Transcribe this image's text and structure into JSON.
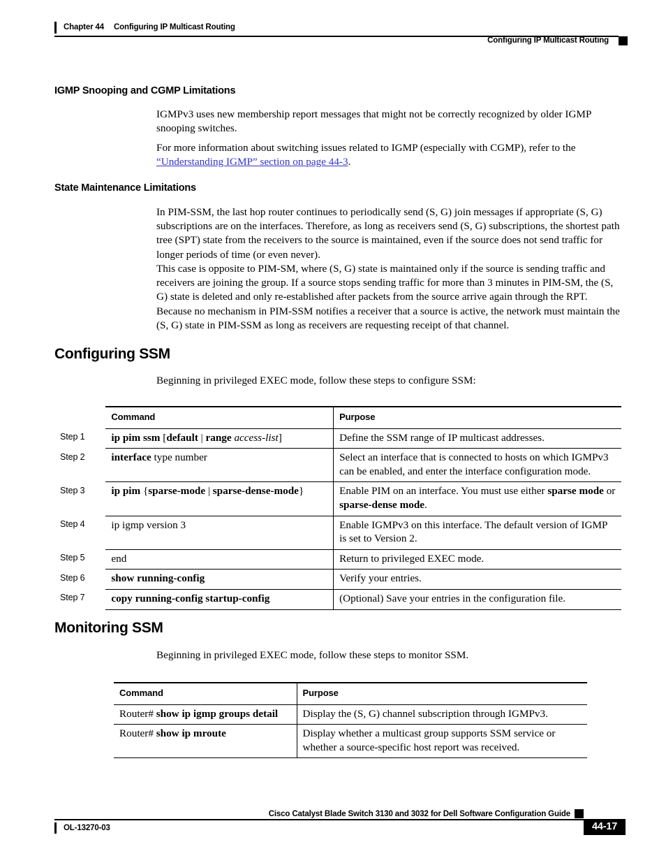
{
  "header": {
    "chapter_number": "Chapter 44",
    "chapter_title": "Configuring IP Multicast Routing",
    "running_title": "Configuring IP Multicast Routing"
  },
  "sections": {
    "igmp_snooping": {
      "heading": "IGMP Snooping and CGMP Limitations",
      "para1": "IGMPv3 uses new membership report messages that might not be correctly recognized by older IGMP snooping switches.",
      "para2_prefix": "For more information about switching issues related to IGMP (especially with CGMP), refer to the ",
      "para2_link": "“Understanding IGMP” section on page 44-3",
      "para2_suffix": "."
    },
    "state_maintenance": {
      "heading": "State Maintenance Limitations",
      "para1": "In PIM-SSM, the last hop router continues to periodically send (S, G) join messages if appropriate (S, G) subscriptions are on the interfaces. Therefore, as long as receivers send (S, G) subscriptions, the shortest path tree (SPT) state from the receivers to the source is maintained, even if the source does not send traffic for longer periods of time (or even never).",
      "para2": "This case is opposite to PIM-SM, where (S, G) state is maintained only if the source is sending traffic and receivers are joining the group. If a source stops sending traffic for more than 3 minutes in PIM-SM, the (S, G) state is deleted and only re-established after packets from the source arrive again through the RPT. Because no mechanism in PIM-SSM notifies a receiver that a source is active, the network must maintain the (S, G) state in PIM-SSM as long as receivers are requesting receipt of that channel."
    },
    "configuring_ssm": {
      "heading": "Configuring SSM",
      "intro": "Beginning in privileged EXEC mode, follow these steps to configure SSM:",
      "table": {
        "col_command": "Command",
        "col_purpose": "Purpose",
        "rows": [
          {
            "step": "Step 1",
            "command_html": "<b>ip pim ssm</b> [<b>default</b> | <b>range</b> <i>access-list</i>]",
            "command_text": "ip pim ssm [default | range access-list]",
            "purpose": "Define the SSM range of IP multicast addresses."
          },
          {
            "step": "Step 2",
            "command_html": "<b>interface</b> type number",
            "command_text": "interface type number",
            "purpose": "Select an interface that is connected to hosts on which IGMPv3 can be enabled, and enter the interface configuration mode."
          },
          {
            "step": "Step 3",
            "command_html": "<b>ip pim</b> {<b>sparse-mode</b> | <b>sparse-dense-mode</b>}",
            "command_text": "ip pim {sparse-mode | sparse-dense-mode}",
            "purpose_html": "Enable PIM on an interface. You must use either <b>sparse mode</b> or <b>sparse-dense mode</b>.",
            "purpose": "Enable PIM on an interface. You must use either sparse mode or sparse-dense mode."
          },
          {
            "step": "Step 4",
            "command_html": "ip igmp version 3",
            "command_text": "ip igmp version 3",
            "purpose": "Enable IGMPv3 on this interface. The default version of IGMP is set to Version 2."
          },
          {
            "step": "Step 5",
            "command_html": "end",
            "command_text": "end",
            "purpose": "Return to privileged EXEC mode."
          },
          {
            "step": "Step 6",
            "command_html": "<b>show running-config</b>",
            "command_text": "show running-config",
            "purpose": "Verify your entries."
          },
          {
            "step": "Step 7",
            "command_html": "<b>copy running-config startup-config</b>",
            "command_text": "copy running-config startup-config",
            "purpose": "(Optional) Save your entries in the configuration file."
          }
        ]
      }
    },
    "monitoring_ssm": {
      "heading": "Monitoring SSM",
      "intro": "Beginning in privileged EXEC mode, follow these steps to monitor SSM.",
      "table": {
        "col_command": "Command",
        "col_purpose": "Purpose",
        "rows": [
          {
            "command_html": "Router# <b>show ip igmp groups detail</b>",
            "command_text": "Router# show ip igmp groups detail",
            "purpose": "Display the (S, G) channel subscription through IGMPv3."
          },
          {
            "command_html": "Router# <b>show ip mroute</b>",
            "command_text": "Router# show ip mroute",
            "purpose": "Display whether a multicast group supports SSM service or whether a source-specific host report was received."
          }
        ]
      }
    }
  },
  "footer": {
    "guide_title": "Cisco Catalyst Blade Switch 3130 and 3032 for Dell Software Configuration Guide",
    "doc_number": "OL-13270-03",
    "page_number": "44-17"
  },
  "colors": {
    "link": "#3333cc",
    "rule": "#000000",
    "page_badge_bg": "#000000",
    "page_badge_fg": "#ffffff"
  }
}
